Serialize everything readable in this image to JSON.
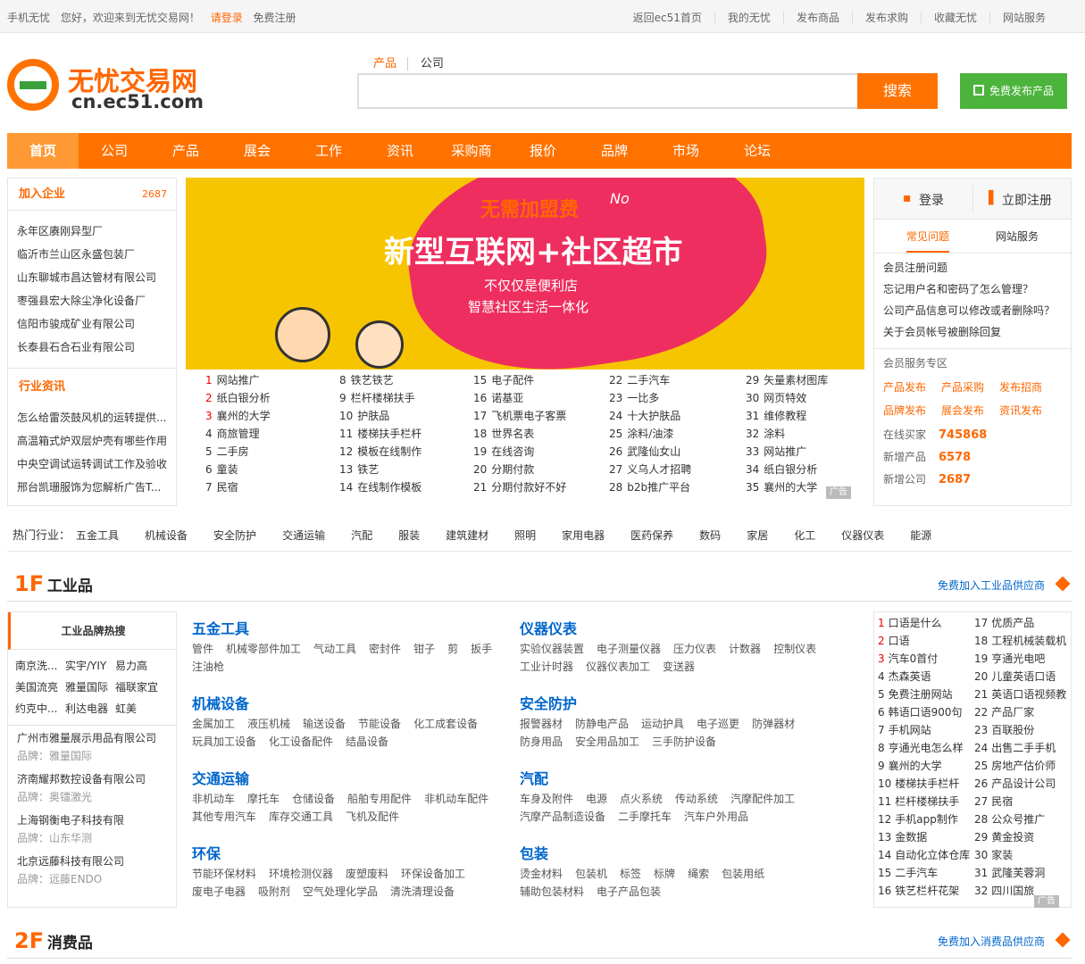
{
  "topbar": {
    "mobile": "手机无忧",
    "welcome": "您好，欢迎来到无忧交易网！",
    "login": "请登录",
    "register": "免费注册",
    "links": [
      "返回ec51首页",
      "我的无忧",
      "发布商品",
      "发布求购",
      "收藏无忧",
      "网站服务"
    ]
  },
  "logo": {
    "name": "无忧交易网",
    "domain": "cn.ec51.com"
  },
  "search": {
    "tab_product": "产品",
    "tab_company": "公司",
    "button": "搜索",
    "placeholder": ""
  },
  "publish_button": "免费发布产品",
  "nav": [
    "首页",
    "公司",
    "产品",
    "展会",
    "工作",
    "资讯",
    "采购商",
    "报价",
    "品牌",
    "市场",
    "论坛"
  ],
  "join_companies": {
    "title": "加入企业",
    "count": "2687",
    "items": [
      "永年区赓刚异型厂",
      "临沂市兰山区永盛包装厂",
      "山东聊城市昌达管材有限公司",
      "枣强县宏大除尘净化设备厂",
      "信阳市骏成矿业有限公司",
      "长泰县石合石业有限公司"
    ]
  },
  "industry_news": {
    "title": "行业资讯",
    "items": [
      "怎么给雷茨鼓风机的运转提供...",
      "高温箱式炉双层炉壳有哪些作用",
      "中央空调试运转调试工作及验收",
      "邢台凯珊服饰为您解析广告T..."
    ]
  },
  "banner": {
    "line1": "无需加盟费",
    "no": "No",
    "line2": "新型互联网+社区超市",
    "line3": "不仅仅是便利店",
    "line4": "智慧社区生活一体化"
  },
  "hot_links": [
    [
      [
        "1",
        "网站推广"
      ],
      [
        "2",
        "纸白银分析"
      ],
      [
        "3",
        "襄州的大学"
      ],
      [
        "4",
        "商旅管理"
      ],
      [
        "5",
        "二手房"
      ],
      [
        "6",
        "童装"
      ],
      [
        "7",
        "民宿"
      ]
    ],
    [
      [
        "8",
        "铁艺铁艺"
      ],
      [
        "9",
        "栏杆楼梯扶手"
      ],
      [
        "10",
        "护肤品"
      ],
      [
        "11",
        "楼梯扶手栏杆"
      ],
      [
        "12",
        "模板在线制作"
      ],
      [
        "13",
        "铁艺"
      ],
      [
        "14",
        "在线制作模板"
      ]
    ],
    [
      [
        "15",
        "电子配件"
      ],
      [
        "16",
        "诺基亚"
      ],
      [
        "17",
        "飞机票电子客票"
      ],
      [
        "18",
        "世界名表"
      ],
      [
        "19",
        "在线咨询"
      ],
      [
        "20",
        "分期付款"
      ],
      [
        "21",
        "分期付款好不好"
      ]
    ],
    [
      [
        "22",
        "二手汽车"
      ],
      [
        "23",
        "一比多"
      ],
      [
        "24",
        "十大护肤品"
      ],
      [
        "25",
        "涂料/油漆"
      ],
      [
        "26",
        "武隆仙女山"
      ],
      [
        "27",
        "义乌人才招聘"
      ],
      [
        "28",
        "b2b推广平台"
      ]
    ],
    [
      [
        "29",
        "矢量素材图库"
      ],
      [
        "30",
        "网页特效"
      ],
      [
        "31",
        "维修教程"
      ],
      [
        "32",
        "涂料"
      ],
      [
        "33",
        "网站推广"
      ],
      [
        "34",
        "纸白银分析"
      ],
      [
        "35",
        "襄州的大学"
      ]
    ]
  ],
  "ad_label": "广告",
  "member": {
    "login": "登录",
    "register": "立即注册",
    "tab_faq": "常见问题",
    "tab_service": "网站服务",
    "faq": [
      "会员注册问题",
      "忘记用户名和密码了怎么管理？",
      "公司产品信息可以修改或者删除吗？",
      "关于会员帐号被删除回复"
    ],
    "zone_title": "会员服务专区",
    "services": [
      "产品发布",
      "产品采购",
      "发布招商",
      "品牌发布",
      "展会发布",
      "资讯发布"
    ],
    "stats": [
      {
        "label": "在线买家",
        "value": "745868"
      },
      {
        "label": "新增产品",
        "value": "6578"
      },
      {
        "label": "新增公司",
        "value": "2687"
      }
    ]
  },
  "hot_industry": {
    "label": "热门行业：",
    "items": [
      "五金工具",
      "机械设备",
      "安全防护",
      "交通运输",
      "汽配",
      "服装",
      "建筑建材",
      "照明",
      "家用电器",
      "医药保养",
      "数码",
      "家居",
      "化工",
      "仪器仪表",
      "能源"
    ]
  },
  "floor1": {
    "num": "1F",
    "title": "工业品",
    "join": "免费加入工业品供应商"
  },
  "floor2": {
    "num": "2F",
    "title": "消费品",
    "join": "免费加入消费品供应商"
  },
  "brand_hot": {
    "title": "工业品牌热搜",
    "grid": [
      [
        "南京洗...",
        "实宇/YIY",
        "易力高"
      ],
      [
        "美国流亮",
        "雅量国际",
        "福联家宜"
      ],
      [
        "约克中...",
        "利达电器",
        "虹美"
      ]
    ],
    "companies": [
      {
        "name": "广州市雅量展示用品有限公司",
        "brand": "品牌：雅量国际"
      },
      {
        "name": "济南耀邦数控设备有限公司",
        "brand": "品牌：奥镭激光"
      },
      {
        "name": "上海钢衡电子科技有限",
        "brand": "品牌：山东华测"
      },
      {
        "name": "北京远藤科技有限公司",
        "brand": "品牌：远藤ENDO"
      }
    ]
  },
  "categories": [
    {
      "title": "五金工具",
      "items": [
        "管件",
        "机械零部件加工",
        "气动工具",
        "密封件",
        "钳子",
        "剪",
        "扳手",
        "注油枪"
      ]
    },
    {
      "title": "仪器仪表",
      "items": [
        "实验仪器装置",
        "电子测量仪器",
        "压力仪表",
        "计数器",
        "控制仪表",
        "工业计时器",
        "仪器仪表加工",
        "变送器"
      ]
    },
    {
      "title": "机械设备",
      "items": [
        "金属加工",
        "液压机械",
        "输送设备",
        "节能设备",
        "化工成套设备",
        "玩具加工设备",
        "化工设备配件",
        "结晶设备"
      ]
    },
    {
      "title": "安全防护",
      "items": [
        "报警器材",
        "防静电产品",
        "运动护具",
        "电子巡更",
        "防弹器材",
        "防身用品",
        "安全用品加工",
        "三手防护设备"
      ]
    },
    {
      "title": "交通运输",
      "items": [
        "非机动车",
        "摩托车",
        "仓储设备",
        "船舶专用配件",
        "非机动车配件",
        "其他专用汽车",
        "库存交通工具",
        "飞机及配件"
      ]
    },
    {
      "title": "汽配",
      "items": [
        "车身及附件",
        "电源",
        "点火系统",
        "传动系统",
        "汽摩配件加工",
        "汽摩产品制造设备",
        "二手摩托车",
        "汽车户外用品"
      ]
    },
    {
      "title": "环保",
      "items": [
        "节能环保材料",
        "环境检测仪器",
        "废塑废料",
        "环保设备加工",
        "废电子电器",
        "吸附剂",
        "空气处理化学品",
        "清洗清理设备"
      ]
    },
    {
      "title": "包装",
      "items": [
        "烫金材料",
        "包装机",
        "标签",
        "标牌",
        "绳索",
        "包装用纸",
        "辅助包装材料",
        "电子产品包装"
      ]
    }
  ],
  "rank": [
    [
      [
        "1",
        "口语是什么"
      ],
      [
        "2",
        "口语"
      ],
      [
        "3",
        "汽车0首付"
      ],
      [
        "4",
        "杰森英语"
      ],
      [
        "5",
        "免费注册网站"
      ],
      [
        "6",
        "韩语口语900句"
      ],
      [
        "7",
        "手机网站"
      ],
      [
        "8",
        "亨通光电怎么样"
      ],
      [
        "9",
        "襄州的大学"
      ],
      [
        "10",
        "楼梯扶手栏杆"
      ],
      [
        "11",
        "栏杆楼梯扶手"
      ],
      [
        "12",
        "手机app制作"
      ],
      [
        "13",
        "金数据"
      ],
      [
        "14",
        "自动化立体仓库"
      ],
      [
        "15",
        "二手汽车"
      ],
      [
        "16",
        "铁艺栏杆花架"
      ]
    ],
    [
      [
        "17",
        "优质产品"
      ],
      [
        "18",
        "工程机械装载机"
      ],
      [
        "19",
        "亨通光电吧"
      ],
      [
        "20",
        "儿童英语口语"
      ],
      [
        "21",
        "英语口语视频教"
      ],
      [
        "22",
        "产品厂家"
      ],
      [
        "23",
        "百联股份"
      ],
      [
        "24",
        "出售二手手机"
      ],
      [
        "25",
        "房地产估价师"
      ],
      [
        "26",
        "产品设计公司"
      ],
      [
        "27",
        "民宿"
      ],
      [
        "28",
        "公众号推广"
      ],
      [
        "29",
        "黄金投资"
      ],
      [
        "30",
        "家装"
      ],
      [
        "31",
        "武隆芙蓉洞"
      ],
      [
        "32",
        "四川国旅"
      ]
    ]
  ]
}
